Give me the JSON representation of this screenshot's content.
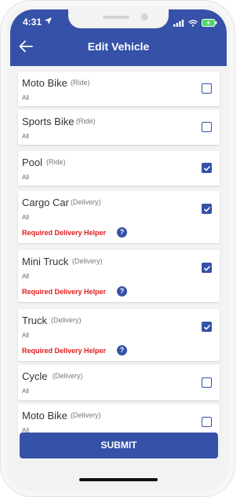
{
  "status_bar": {
    "time": "4:31"
  },
  "header": {
    "title": "Edit Vehicle"
  },
  "vehicles": [
    {
      "name": "Moto Bike",
      "type": "(Ride)",
      "sub": "All",
      "checked": false,
      "helper": ""
    },
    {
      "name": "Sports Bike",
      "type": "(Ride)",
      "sub": "All",
      "checked": false,
      "helper": ""
    },
    {
      "name": "Pool",
      "type": "(Ride)",
      "sub": "All",
      "checked": true,
      "helper": ""
    },
    {
      "name": "Cargo Car",
      "type": "(Delivery)",
      "sub": "All",
      "checked": true,
      "helper": "Required Delivery Helper"
    },
    {
      "name": "Mini Truck",
      "type": "(Delivery)",
      "sub": "All",
      "checked": true,
      "helper": "Required Delivery Helper"
    },
    {
      "name": "Truck",
      "type": "(Delivery)",
      "sub": "All",
      "checked": true,
      "helper": "Required Delivery Helper"
    },
    {
      "name": "Cycle",
      "type": "(Delivery)",
      "sub": "All",
      "checked": false,
      "helper": ""
    },
    {
      "name": "Moto Bike",
      "type": "(Delivery)",
      "sub": "All",
      "checked": false,
      "helper": ""
    }
  ],
  "icons": {
    "back": "arrow-left-icon",
    "location": "location-arrow-icon",
    "signal": "signal-bars-icon",
    "wifi": "wifi-icon",
    "battery": "battery-charging-icon",
    "help": "question-circle-icon",
    "check": "checkmark-icon",
    "help_glyph": "?"
  },
  "submit": {
    "label": "SUBMIT"
  },
  "colors": {
    "primary": "#3551a8",
    "helper_text": "#e21b1b",
    "battery": "#4cd964"
  }
}
